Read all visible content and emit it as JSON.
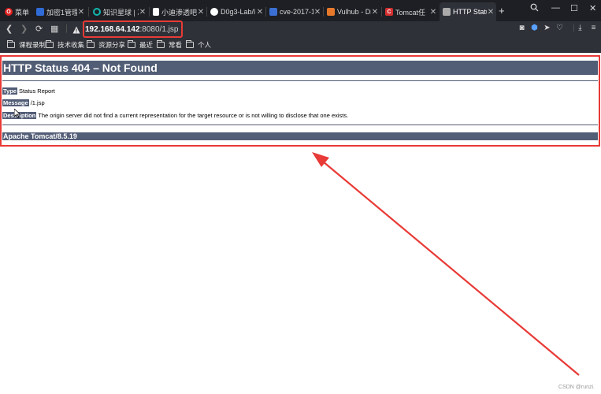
{
  "tabs": [
    {
      "title": "菜单",
      "fav_color": "#e02020",
      "fav_glyph": "O",
      "active": false
    },
    {
      "title": "加密1管理",
      "fav_color": "#2f6cd8",
      "fav_glyph": "",
      "active": false
    },
    {
      "title": "知识星球 | 次",
      "fav_color": "#12b7b0",
      "fav_glyph": "",
      "active": false
    },
    {
      "title": "小迪渗透吧",
      "fav_color": "#ffffff",
      "fav_glyph": "",
      "active": false
    },
    {
      "title": "D0g3-Lab/l",
      "fav_color": "#ffffff",
      "fav_glyph": "",
      "active": false
    },
    {
      "title": "cve-2017-1",
      "fav_color": "#3b6fd4",
      "fav_glyph": "",
      "active": false
    },
    {
      "title": "Vulhub - Di",
      "fav_color": "#e8792b",
      "fav_glyph": "",
      "active": false
    },
    {
      "title": "Tomcat任",
      "fav_color": "#d32f2f",
      "fav_glyph": "C",
      "active": false
    },
    {
      "title": "HTTP Statu",
      "fav_color": "#aaaaaa",
      "fav_glyph": "",
      "active": true
    }
  ],
  "url": {
    "host": "192.168.64.142",
    "rest": ":8080/1.jsp"
  },
  "bookmarks": [
    "课程录制",
    "技术收集",
    "资源分享",
    "最近",
    "常看",
    "个人"
  ],
  "page": {
    "title": "HTTP Status 404 – Not Found",
    "type_label": "Type",
    "type_value": "Status Report",
    "message_label": "Message",
    "message_value": "/1.jsp",
    "description_label": "Description",
    "description_value": "The origin server did not find a current representation for the target resource or is not willing to disclose that one exists.",
    "footer": "Apache Tomcat/8.5.19"
  },
  "watermark": "CSDN @runzi.",
  "colors": {
    "accent_red": "#e83a36",
    "tomcat_bar": "#525d76",
    "browser_dark": "#2e3138"
  }
}
